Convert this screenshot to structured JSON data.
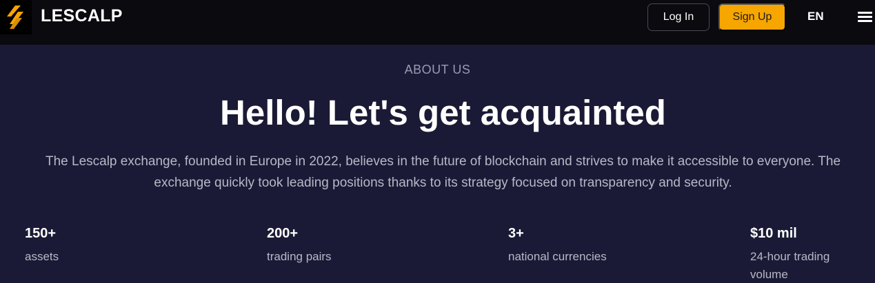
{
  "header": {
    "brand": "LESCALP",
    "login_label": "Log In",
    "signup_label": "Sign Up",
    "language": "EN",
    "logo_icon": "lightning-bolt-logo",
    "menu_icon": "hamburger-menu-icon"
  },
  "about": {
    "eyebrow": "ABOUT US",
    "title": "Hello! Let's get acquainted",
    "description": "The Lescalp exchange, founded in Europe in 2022, believes in the future of blockchain and strives to make it accessible to everyone. The exchange quickly took leading positions thanks to its strategy focused on transparency and security."
  },
  "stats": [
    {
      "value": "150+",
      "label": "assets"
    },
    {
      "value": "200+",
      "label": "trading pairs"
    },
    {
      "value": "3+",
      "label": "national currencies"
    },
    {
      "value": "$10 mil",
      "label": "24-hour trading volume"
    }
  ],
  "colors": {
    "accent": "#f7a600",
    "background": "#1a1a36",
    "header_background": "#0a0a0f"
  }
}
